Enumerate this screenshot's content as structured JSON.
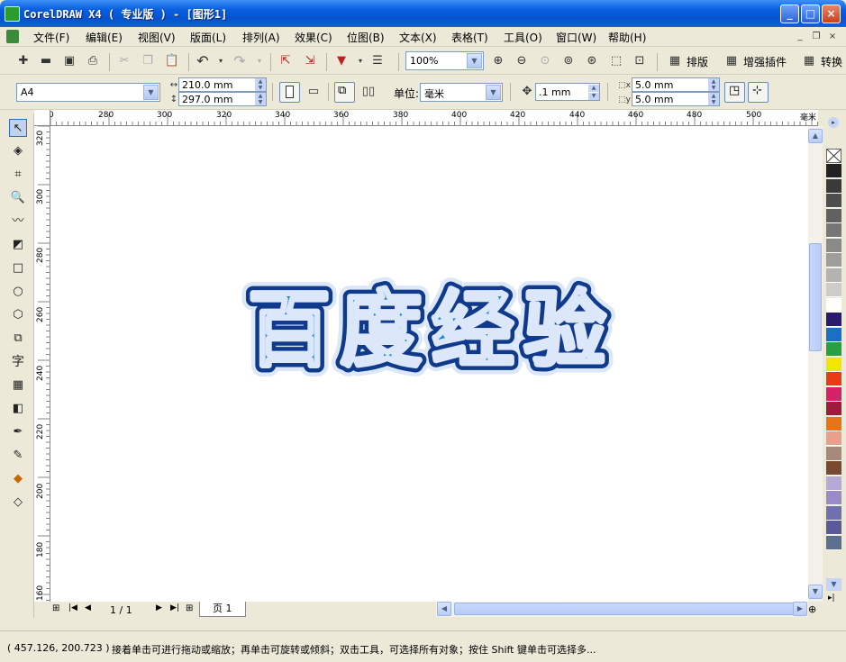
{
  "window": {
    "title": "CorelDRAW X4 ( 专业版 ) - [图形1]",
    "minimize": "_",
    "maximize": "□",
    "close": "×"
  },
  "menu": {
    "items": [
      "文件(F)",
      "编辑(E)",
      "视图(V)",
      "版面(L)",
      "排列(A)",
      "效果(C)",
      "位图(B)",
      "文本(X)",
      "表格(T)",
      "工具(O)",
      "窗口(W)",
      "帮助(H)"
    ],
    "doc_minimize": "_",
    "doc_restore": "❐",
    "doc_close": "×"
  },
  "standard_toolbar": {
    "zoom": "100%",
    "plugin_layout": "排版",
    "plugin_enhance": "增强插件",
    "plugin_convert": "转换"
  },
  "property_bar": {
    "page_size": "A4",
    "width": "210.0 mm",
    "height": "297.0 mm",
    "unit_label": "单位:",
    "unit": "毫米",
    "nudge": ".1 mm",
    "dup_x": "5.0 mm",
    "dup_y": "5.0 mm"
  },
  "rulers": {
    "unit_label": "毫米",
    "h_ticks": [
      "0",
      "280",
      "300",
      "320",
      "340",
      "360",
      "380",
      "400",
      "420",
      "440",
      "460",
      "480",
      "500"
    ],
    "v_ticks": [
      "320",
      "300",
      "280",
      "260",
      "240",
      "220",
      "200",
      "180",
      "160"
    ]
  },
  "canvas": {
    "artwork_text": "百度经验",
    "fill_color": "#1a82d8",
    "outline_color": "#103a8c",
    "halo_color": "#dce8fa"
  },
  "page_nav": {
    "counter": "1 / 1",
    "page_tab": "页 1"
  },
  "palette": [
    "#222222",
    "#3a3a3a",
    "#4d4d4d",
    "#616161",
    "#767676",
    "#8a8a8a",
    "#9e9e9e",
    "#b3b3b3",
    "#cccccc",
    "#ffffff",
    "#2a1a70",
    "#1a6fc8",
    "#26a040",
    "#f2e600",
    "#e83c16",
    "#d62068",
    "#a01a40",
    "#e87418",
    "#e8a08a",
    "#a88a7a",
    "#7a4a30",
    "#b8a8d8",
    "#9a8ac8",
    "#7070b0",
    "#5a5a98",
    "#5e7090"
  ],
  "status": {
    "coords": "( 457.126, 200.723 )",
    "hint": "接着单击可进行拖动或缩放；再单击可旋转或倾斜；双击工具，可选择所有对象；按住 Shift 键单击可选择多..."
  }
}
